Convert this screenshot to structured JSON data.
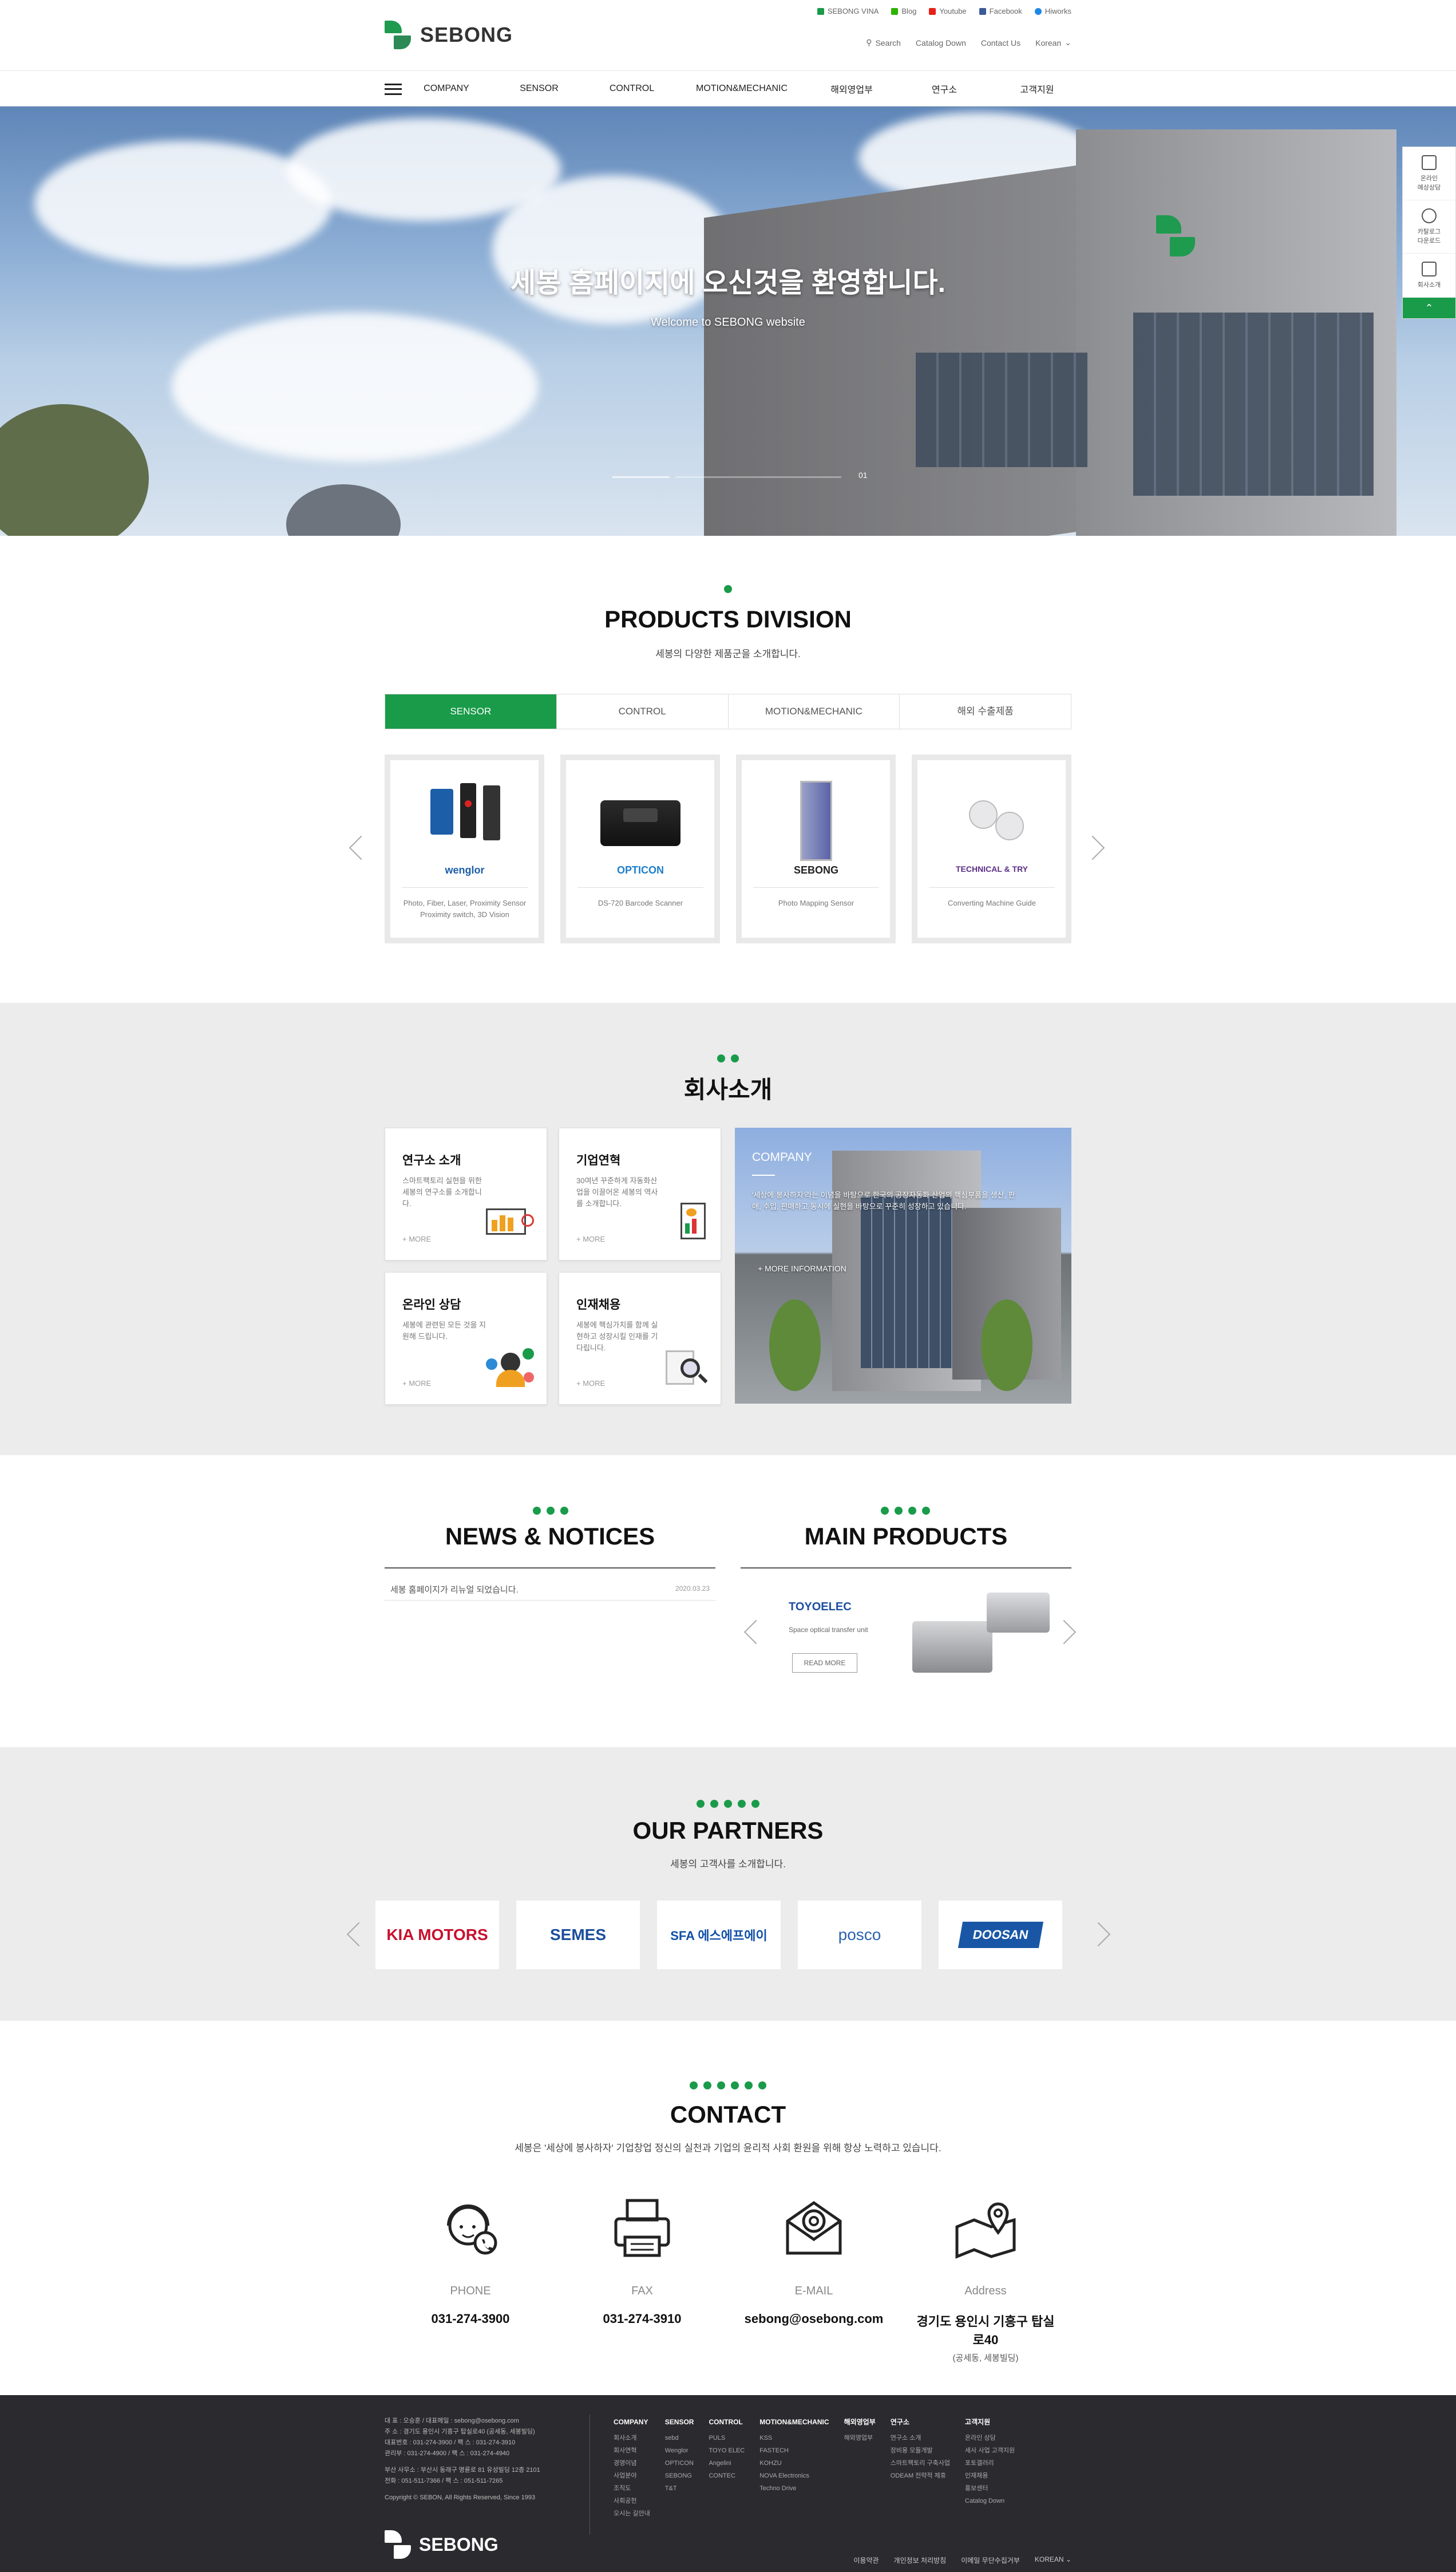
{
  "brand": {
    "name": "SEBONG",
    "accent": "#1a9b4a"
  },
  "util_top": [
    "SEBONG VINA",
    "Blog",
    "Youtube",
    "Facebook",
    "Hiworks"
  ],
  "util_bottom": [
    "Search",
    "Catalog Down",
    "Contact Us",
    "Korean"
  ],
  "gnb": [
    "COMPANY",
    "SENSOR",
    "CONTROL",
    "MOTION&MECHANIC",
    "해외영업부",
    "연구소",
    "고객지원"
  ],
  "hero": {
    "title": "세봉 홈페이지에 오신것을 환영합니다.",
    "subtitle": "Welcome to SEBONG website",
    "counter": "01"
  },
  "quick": [
    {
      "label": "온라인\n예상상담",
      "icon": "headset-icon"
    },
    {
      "label": "카탈로그\n다운로드",
      "icon": "download-icon"
    },
    {
      "label": "회사소개",
      "icon": "document-icon"
    }
  ],
  "products": {
    "title": "PRODUCTS DIVISION",
    "subtitle": "세봉의 다양한 제품군을 소개합니다.",
    "tabs": [
      "SENSOR",
      "CONTROL",
      "MOTION&MECHANIC",
      "해외 수출제품"
    ],
    "cards": [
      {
        "brand": "wenglor",
        "desc": "Photo, Fiber, Laser, Proximity Sensor\nProximity switch, 3D Vision"
      },
      {
        "brand": "OPTICON",
        "desc": "DS-720 Barcode Scanner"
      },
      {
        "brand": "SEBONG",
        "desc": "Photo Mapping Sensor"
      },
      {
        "brand": "TECHNICAL & TRY",
        "desc": "Converting Machine Guide"
      }
    ]
  },
  "company": {
    "title": "회사소개",
    "boxes": [
      {
        "title": "연구소 소개",
        "text": "스마트팩토리 실현을 위한 세봉의 연구소를 소개합니다.",
        "more": "+ MORE"
      },
      {
        "title": "기업연혁",
        "text": "30여년 꾸준하게 자동화산업을 이끌어온 세봉의 역사를 소개합니다.",
        "more": "+ MORE"
      },
      {
        "title": "온라인 상담",
        "text": "세봉에 관련된 모든 것을 지원해 드립니다.",
        "more": "+ MORE"
      },
      {
        "title": "인재채용",
        "text": "세봉에 핵심가치를 함께 실현하고 성장시킬 인재를 기다립니다.",
        "more": "+ MORE"
      }
    ],
    "photo": {
      "title": "COMPANY",
      "text": "'세상에 봉사하자'라는 이념을 바탕으로 한국의 공장자동화 산업의 핵심부품을 생산, 판매, 수입, 판매하고 동시에 실현을 바탕으로 꾸준히 성장하고 있습니다.",
      "more": "+ MORE INFORMATION"
    }
  },
  "news": {
    "title": "NEWS & NOTICES",
    "items": [
      {
        "title": "세봉 홈페이지가 리뉴얼 되었습니다.",
        "date": "2020.03.23"
      }
    ]
  },
  "main_products": {
    "title": "MAIN PRODUCTS",
    "brand": "TOYOELEC",
    "caption": "Space optical transfer unit",
    "button": "READ MORE"
  },
  "partners": {
    "title": "OUR PARTNERS",
    "subtitle": "세봉의 고객사를 소개합니다.",
    "logos": [
      {
        "name": "KIA MOTORS",
        "color": "#c8102e"
      },
      {
        "name": "SEMES",
        "color": "#1b4d9c"
      },
      {
        "name": "SFA 에스에프에이",
        "color": "#0f4fa8"
      },
      {
        "name": "posco",
        "color": "#2a63b0"
      },
      {
        "name": "DOOSAN",
        "color": "#ffffff"
      }
    ]
  },
  "contact": {
    "title": "CONTACT",
    "subtitle": "세봉은 '세상에 봉사하자' 기업창업 정신의 실천과 기업의 윤리적 사회 환원을 위해 항상 노력하고 있습니다.",
    "items": [
      {
        "label": "PHONE",
        "value": "031-274-3900",
        "icon": "headset-person-icon"
      },
      {
        "label": "FAX",
        "value": "031-274-3910",
        "icon": "fax-icon"
      },
      {
        "label": "E-MAIL",
        "value": "sebong@osebong.com",
        "icon": "mail-at-icon"
      },
      {
        "label": "Address",
        "value": "경기도 용인시 기흥구 탑실로40",
        "value2": "(공세동, 세봉빌딩)",
        "icon": "map-pin-icon"
      }
    ]
  },
  "footer": {
    "info": [
      "대 표 : 오승훈 / 대표메일 : sebong@osebong.com",
      "주 소 : 경기도 용인시 기흥구 탑실로40 (공세동, 세봉빌딩)",
      "대표번호 : 031-274-3900 / 팩 스 : 031-274-3910",
      "관리부 : 031-274-4900 / 팩 스 : 031-274-4940",
      "",
      "부산 사무소 : 부산시 동래구 명륜로 81 유성빌딩 12층 2101",
      "전화 : 051-511-7366 / 팩 스 : 051-511-7265",
      "",
      "Copyright © SEBON, All Rights Reserved, Since 1993"
    ],
    "cols": [
      {
        "h": "COMPANY",
        "items": [
          "회사소개",
          "회사연혁",
          "경영이념",
          "사업분야",
          "조직도",
          "사회공헌",
          "오시는 길안내"
        ]
      },
      {
        "h": "SENSOR",
        "items": [
          "sebd",
          "Wenglor",
          "OPTICON",
          "SEBONG",
          "T&T"
        ]
      },
      {
        "h": "CONTROL",
        "items": [
          "PULS",
          "TOYO ELEC",
          "Angelini",
          "CONTEC"
        ]
      },
      {
        "h": "MOTION&MECHANIC",
        "items": [
          "KSS",
          "FASTECH",
          "KOHZU",
          "NOVA Electronics",
          "Techno Drive"
        ]
      },
      {
        "h": "해외영업부",
        "items": [
          "해외영업부"
        ]
      },
      {
        "h": "연구소",
        "items": [
          "연구소 소개",
          "장비용 모듈개발",
          "스마트팩토리 구축사업",
          "ODEAM 전략적 제휴"
        ]
      },
      {
        "h": "고객지원",
        "items": [
          "온라인 상담",
          "세사 사업 고객지원",
          "포토갤러리",
          "인재채용",
          "홍보센터",
          "Catalog Down"
        ]
      }
    ],
    "links": [
      "이용약관",
      "개인정보 처리방침",
      "이메일 무단수집거부",
      "KOREAN"
    ]
  }
}
